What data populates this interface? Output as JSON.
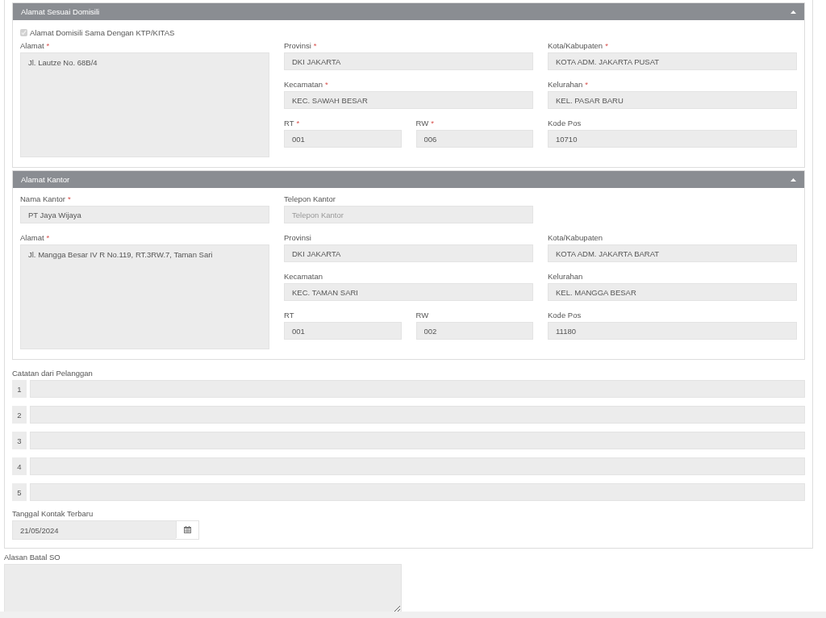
{
  "sections": [
    {
      "title": "Alamat Sesuai Domisili",
      "expanded": true,
      "checkbox": {
        "label": "Alamat Domisili Sama Dengan KTP/KITAS",
        "checked": true,
        "disabled": true
      },
      "fields": [
        {
          "kind": "textarea",
          "label": "Alamat",
          "required_mark": "*",
          "value": "Jl. Lautze No. 68B/4"
        },
        {
          "kind": "wide",
          "label": "Provinsi",
          "required_mark": "*",
          "value": "DKI JAKARTA"
        },
        {
          "kind": "wide",
          "label": "Kota/Kabupaten",
          "required_mark": "*",
          "value": "KOTA ADM. JAKARTA PUSAT"
        },
        {
          "kind": "wide",
          "label": "Kecamatan",
          "required_mark": "*",
          "value": "KEC. SAWAH BESAR"
        },
        {
          "kind": "wide",
          "label": "Kelurahan",
          "required_mark": "*",
          "value": "KEL. PASAR BARU"
        },
        {
          "kind": "narrow",
          "label": "RT",
          "required_mark": "*",
          "value": "001"
        },
        {
          "kind": "narrow",
          "label": "RW",
          "required_mark": "*",
          "value": "006"
        },
        {
          "kind": "wide",
          "label": "Kode Pos",
          "value": "10710"
        }
      ]
    },
    {
      "title": "Alamat Kantor",
      "expanded": true,
      "fields": [
        {
          "kind": "wide",
          "label": "Nama Kantor",
          "required_mark": "*",
          "value": "PT Jaya Wijaya"
        },
        {
          "kind": "wide",
          "label": "Telepon Kantor",
          "placeholder": "Telepon Kantor"
        },
        {
          "kind": "textarea",
          "label": "Alamat",
          "required_mark": "*",
          "value": "Jl. Mangga Besar IV R No.119, RT.3RW.7, Taman Sari"
        },
        {
          "kind": "wide",
          "label": "Provinsi",
          "value": "DKI JAKARTA"
        },
        {
          "kind": "wide",
          "label": "Kota/Kabupaten",
          "value": "KOTA ADM. JAKARTA BARAT"
        },
        {
          "kind": "wide",
          "label": "Kecamatan",
          "value": "KEC. TAMAN SARI"
        },
        {
          "kind": "wide",
          "label": "Kelurahan",
          "value": "KEL. MANGGA BESAR"
        },
        {
          "kind": "narrow",
          "label": "RT",
          "value": "001"
        },
        {
          "kind": "narrow",
          "label": "RW",
          "value": "002"
        },
        {
          "kind": "wide",
          "label": "Kode Pos",
          "value": "11180"
        }
      ]
    }
  ],
  "customer_notes": {
    "label": "Catatan dari Pelanggan",
    "rows": [
      {
        "number": "1"
      },
      {
        "number": "2"
      },
      {
        "number": "3"
      },
      {
        "number": "4"
      },
      {
        "number": "5"
      }
    ]
  },
  "last_contact": {
    "label": "Tanggal Kontak Terbaru",
    "value": "21/05/2024"
  },
  "cancel_reason": {
    "label": "Alasan Batal SO"
  }
}
